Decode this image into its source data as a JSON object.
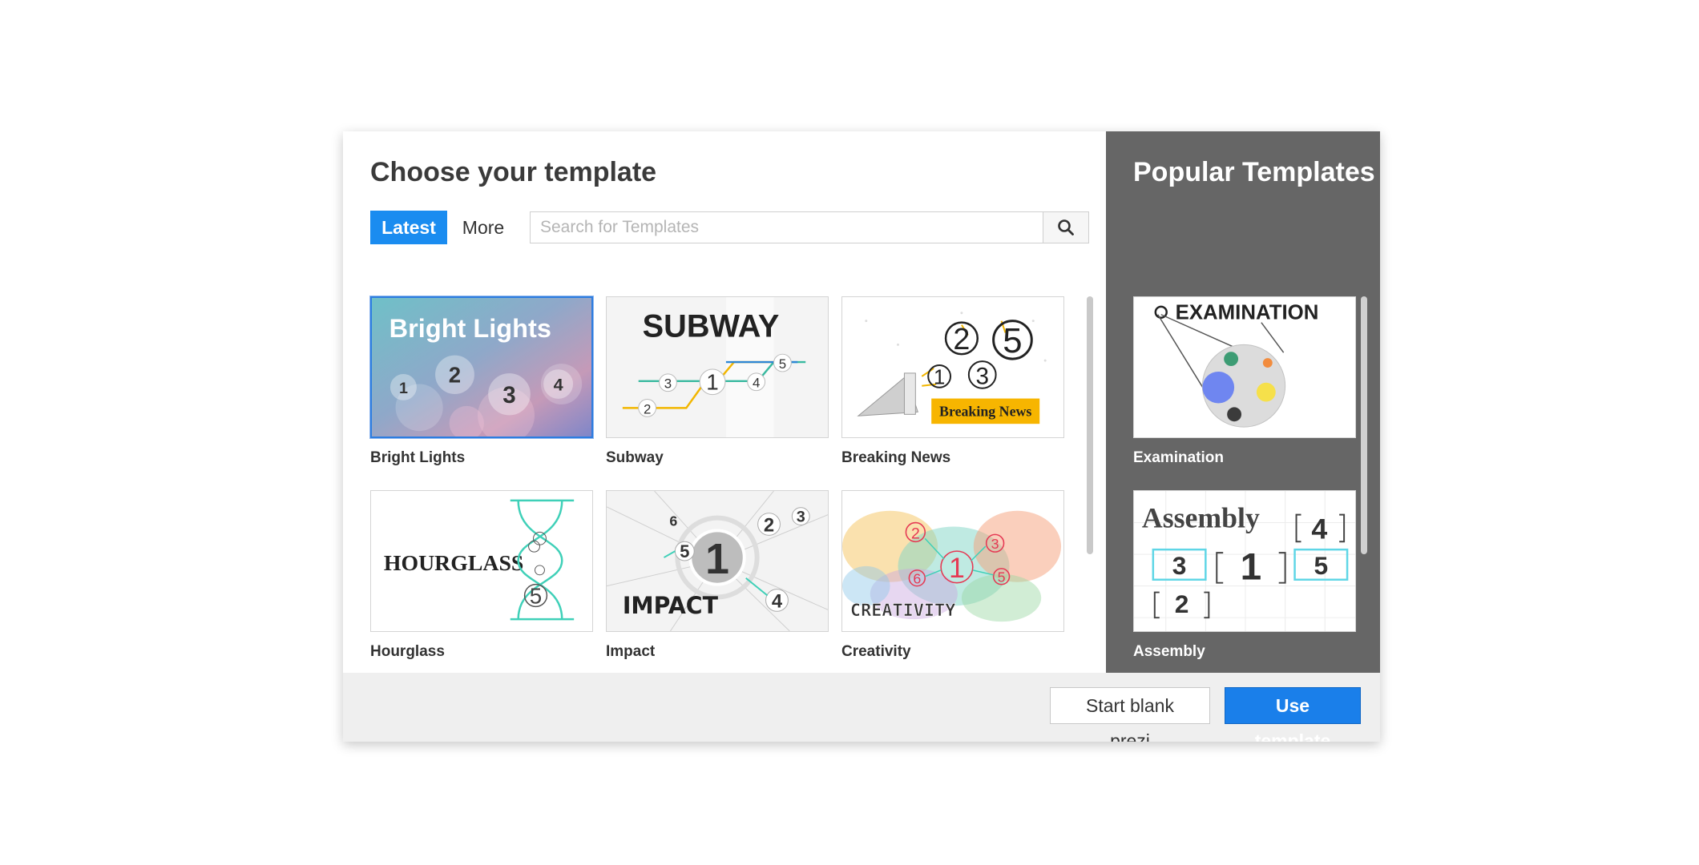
{
  "dialog": {
    "title": "Choose your template",
    "tabs": {
      "latest": "Latest",
      "more": "More"
    },
    "search": {
      "placeholder": "Search for Templates"
    }
  },
  "templates": [
    {
      "label": "Bright Lights",
      "selected": true
    },
    {
      "label": "Subway"
    },
    {
      "label": "Breaking News"
    },
    {
      "label": "Hourglass"
    },
    {
      "label": "Impact"
    },
    {
      "label": "Creativity"
    }
  ],
  "thumb_text": {
    "bright_lights": {
      "title": "Bright Lights",
      "nums": [
        "1",
        "2",
        "3",
        "4"
      ]
    },
    "subway": {
      "title": "SUBWAY",
      "nums": [
        "3",
        "1",
        "4",
        "5",
        "2"
      ]
    },
    "breaking": {
      "banner": "Breaking News",
      "nums": [
        "2",
        "5",
        "1",
        "3"
      ]
    },
    "hourglass": {
      "title": "HOURGLASS",
      "nums": [
        "5"
      ]
    },
    "impact": {
      "title": "IMPACT",
      "nums": [
        "6",
        "2",
        "3",
        "5",
        "1",
        "4"
      ]
    },
    "creativity": {
      "title": "CREATIVITY",
      "nums": [
        "2",
        "3",
        "1",
        "6",
        "5"
      ]
    },
    "examination": {
      "title": "EXAMINATION"
    },
    "assembly": {
      "title": "Assembly",
      "nums": [
        "4",
        "3",
        "1",
        "5",
        "2"
      ]
    }
  },
  "popular": {
    "title": "Popular Templates",
    "items": [
      {
        "label": "Examination"
      },
      {
        "label": "Assembly"
      }
    ]
  },
  "footer": {
    "blank_label": "Start blank prezi",
    "use_label": "Use template"
  },
  "colors": {
    "accent": "#1a8cf0",
    "side_panel": "#666666",
    "footer": "#efefef"
  },
  "icons": {
    "search": "search-icon"
  }
}
